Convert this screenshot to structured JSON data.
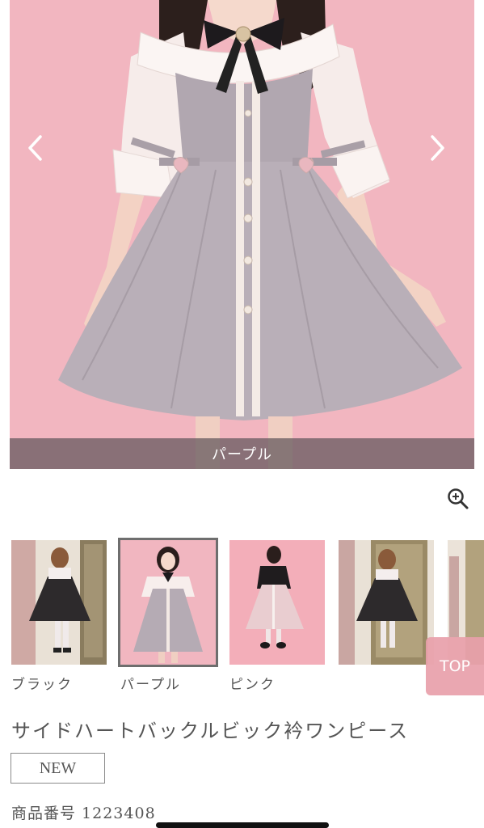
{
  "hero": {
    "caption": "パープル",
    "prev_icon": "chevron-left-icon",
    "next_icon": "chevron-right-icon",
    "background": "#f2b6c0"
  },
  "zoom": {
    "icon": "zoom-in-icon"
  },
  "thumbnails": [
    {
      "label": "ブラック",
      "selected": false
    },
    {
      "label": "パープル",
      "selected": true
    },
    {
      "label": "ピンク",
      "selected": false
    },
    {
      "label": "",
      "selected": false
    },
    {
      "label": "",
      "selected": false
    }
  ],
  "top_button": {
    "label": "TOP",
    "color": "#e8a0aa"
  },
  "product": {
    "title": "サイドハートバックルビック衿ワンピース",
    "badge": "NEW",
    "code": "商品番号 1223408"
  }
}
